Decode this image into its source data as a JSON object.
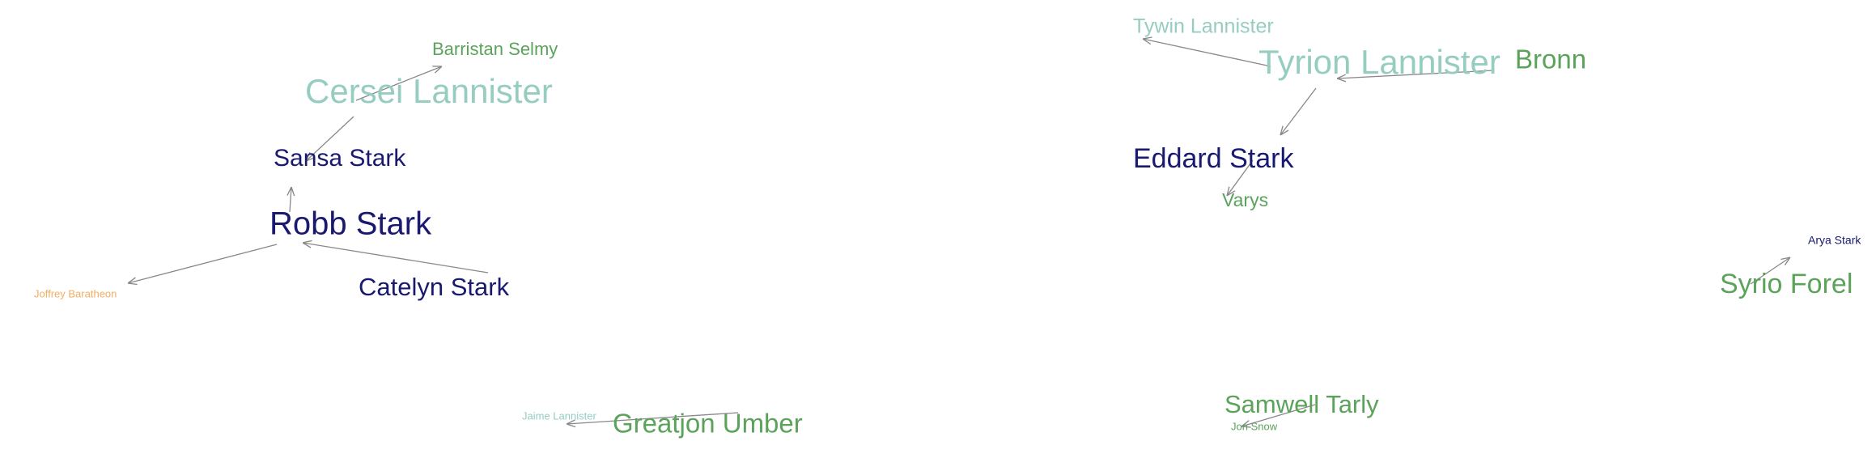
{
  "colors": {
    "stark": "#191970",
    "lannister": "#96cdc0",
    "other": "#5ba35b",
    "baratheon": "#f2ae63",
    "edge": "#888888"
  },
  "nodes": {
    "barristan": {
      "label": "Barristan Selmy",
      "group": "other"
    },
    "cersei": {
      "label": "Cersei Lannister",
      "group": "lannister"
    },
    "sansa": {
      "label": "Sansa Stark",
      "group": "stark"
    },
    "robb": {
      "label": "Robb Stark",
      "group": "stark"
    },
    "catelyn": {
      "label": "Catelyn Stark",
      "group": "stark"
    },
    "joffrey": {
      "label": "Joffrey Baratheon",
      "group": "baratheon"
    },
    "jaime": {
      "label": "Jaime Lannister",
      "group": "lannister"
    },
    "greatjon": {
      "label": "Greatjon Umber",
      "group": "other"
    },
    "tywin": {
      "label": "Tywin Lannister",
      "group": "lannister"
    },
    "tyrion": {
      "label": "Tyrion Lannister",
      "group": "lannister"
    },
    "bronn": {
      "label": "Bronn",
      "group": "other"
    },
    "eddard": {
      "label": "Eddard Stark",
      "group": "stark"
    },
    "varys": {
      "label": "Varys",
      "group": "other"
    },
    "samwell": {
      "label": "Samwell Tarly",
      "group": "other"
    },
    "jon": {
      "label": "Jon Snow",
      "group": "other"
    },
    "arya": {
      "label": "Arya Stark",
      "group": "stark"
    },
    "syrio": {
      "label": "Syrio Forel",
      "group": "other"
    }
  },
  "edges": [
    {
      "from": "cersei",
      "to": "barristan"
    },
    {
      "from": "cersei",
      "to": "sansa"
    },
    {
      "from": "sansa",
      "to": "robb"
    },
    {
      "from": "robb",
      "to": "joffrey"
    },
    {
      "from": "catelyn",
      "to": "robb"
    },
    {
      "from": "greatjon",
      "to": "jaime"
    },
    {
      "from": "tyrion",
      "to": "tywin"
    },
    {
      "from": "bronn",
      "to": "tyrion"
    },
    {
      "from": "tyrion",
      "to": "eddard"
    },
    {
      "from": "eddard",
      "to": "varys"
    },
    {
      "from": "samwell",
      "to": "jon"
    },
    {
      "from": "syrio",
      "to": "arya"
    }
  ]
}
